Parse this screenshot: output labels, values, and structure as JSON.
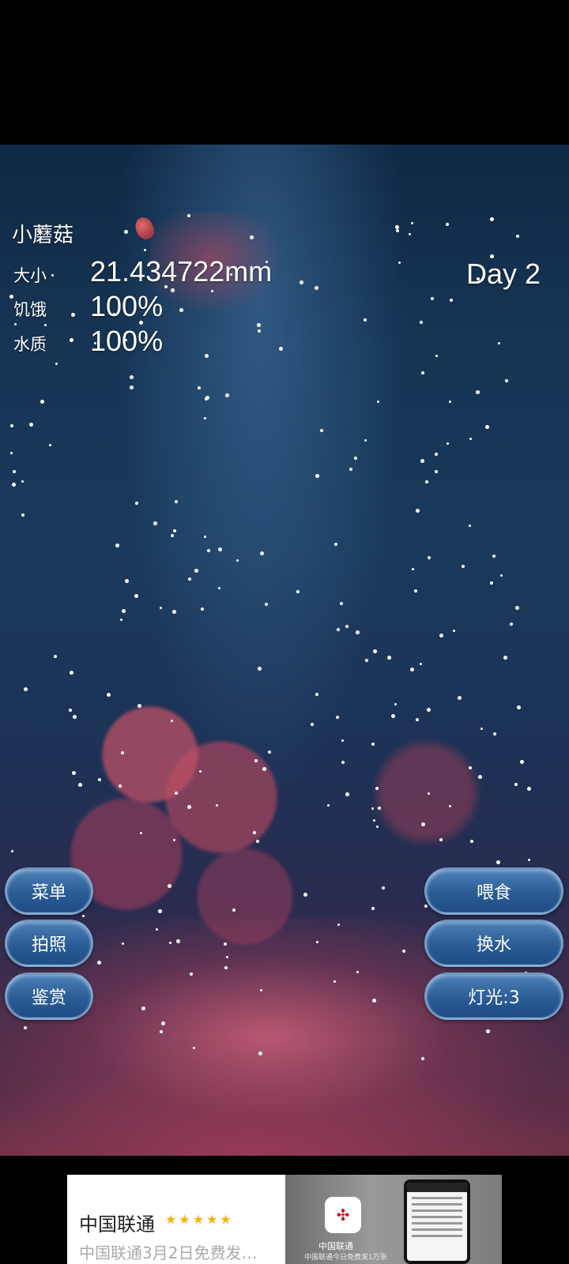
{
  "pet": {
    "name": "小蘑菇",
    "size_label": "大小",
    "size_value": "21.434722mm",
    "hunger_label": "饥饿",
    "hunger_value": "100%",
    "water_label": "水质",
    "water_value": "100%",
    "day": "Day 2"
  },
  "left_buttons": [
    "菜单",
    "拍照",
    "鉴赏"
  ],
  "right_buttons": [
    "喂食",
    "换水",
    "灯光:3"
  ],
  "ad": {
    "brand": "中国联通",
    "stars": "★★★★★",
    "description": "中国联通3月2日免费发…",
    "app_name": "中国联通",
    "app_desc": "中国联通今日免费发1万张",
    "close": "✕"
  }
}
